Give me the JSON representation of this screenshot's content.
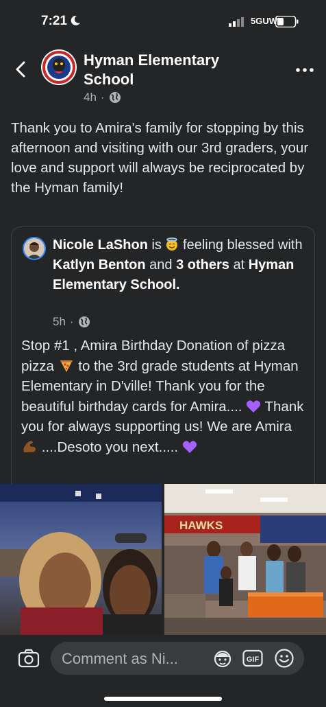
{
  "status_bar": {
    "time": "7:21",
    "network": "5GUW"
  },
  "post": {
    "page_name": "Hyman Elementary School",
    "time_ago": "4h",
    "separator": "·",
    "text": "Thank you to Amira's family for stopping by this afternoon and visiting with our 3rd graders, your love and support will always be reciprocated by the Hyman family!"
  },
  "shared_post": {
    "author": "Nicole LaShon",
    "is_text": "is",
    "feeling_text": "feeling blessed with",
    "tagged_person": "Katlyn Benton",
    "and_text": "and",
    "others": "3 others",
    "at_text": "at",
    "location": "Hyman Elementary School.",
    "time_ago": "5h",
    "separator": "·",
    "text_part1": "Stop #1 , Amira Birthday Donation of pizza pizza",
    "text_part2": "to the 3rd grade students at Hyman Elementary in D'ville! Thank you for the beautiful birthday cards for Amira....",
    "text_part3": "Thank you for always supporting us! We are Amira",
    "text_part4": "....Desoto you next.....",
    "banner_text": "HAWKS"
  },
  "comment_bar": {
    "placeholder": "Comment as Ni..."
  },
  "icons": [
    "back-arrow-icon",
    "more-icon",
    "globe-icon",
    "camera-icon",
    "avatar-sticker-icon",
    "gif-icon",
    "emoji-icon"
  ],
  "colors": {
    "background": "#242526",
    "input": "#3a3b3c",
    "accent": "#2d88ff",
    "muted": "#b0b3b8"
  }
}
